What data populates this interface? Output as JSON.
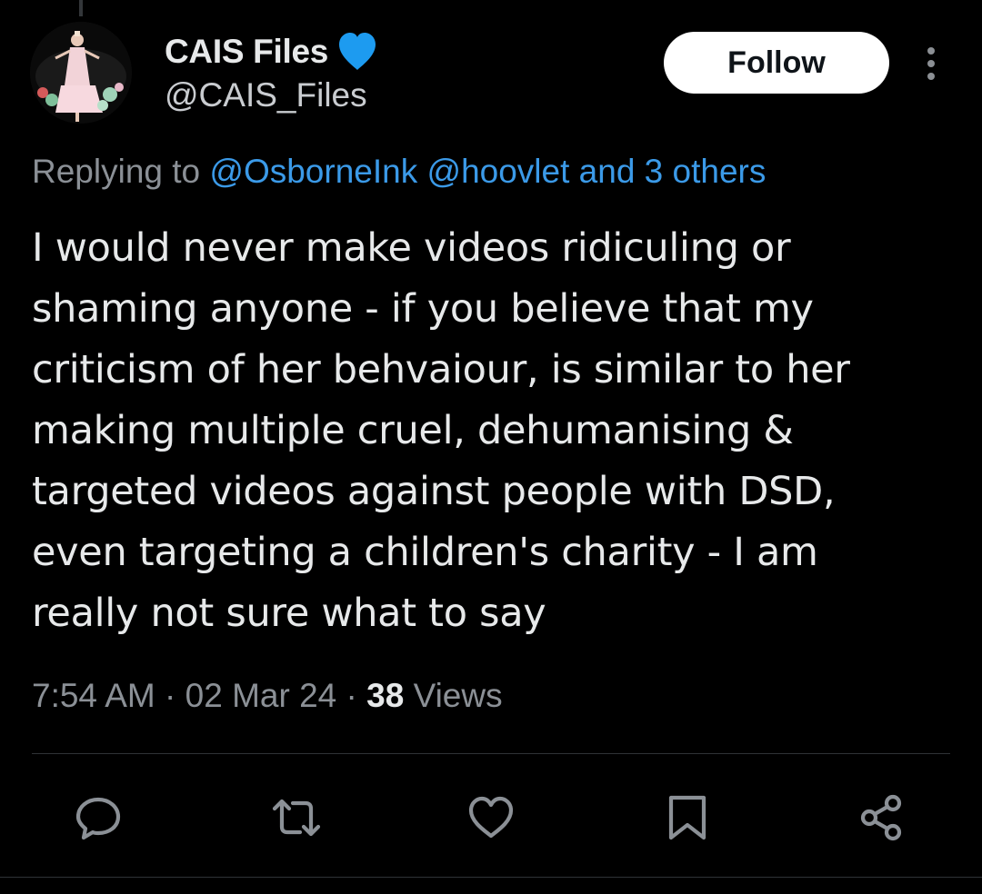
{
  "tweet": {
    "author": {
      "display_name": "CAIS Files",
      "handle": "@CAIS_Files",
      "verified_badge_color": "#1d9bf0"
    },
    "follow_label": "Follow",
    "reply_prefix": "Replying to",
    "reply_mentions": [
      "@OsborneInk",
      "@hoovlet",
      "and 3 others"
    ],
    "text_lines": [
      "I would never make videos ridiculing or",
      "shaming anyone - if you believe that my",
      "criticism of her behvaiour, is similar to her",
      "making multiple cruel, dehumanising &",
      "targeted videos against people with DSD,",
      "even targeting a children's charity - I am",
      "really not sure what to say"
    ],
    "time": "7:54 AM",
    "separator": "·",
    "date": "02 Mar 24",
    "views_count": "38",
    "views_label": "Views"
  },
  "actions": {
    "reply_icon": "reply-icon",
    "retweet_icon": "retweet-icon",
    "like_icon": "heart-icon",
    "bookmark_icon": "bookmark-icon",
    "share_icon": "share-icon"
  },
  "colors": {
    "background": "#000000",
    "text": "#e7e9ea",
    "secondary_text": "#8b9096",
    "link": "#3b9ae8",
    "icon": "#8b9096"
  }
}
